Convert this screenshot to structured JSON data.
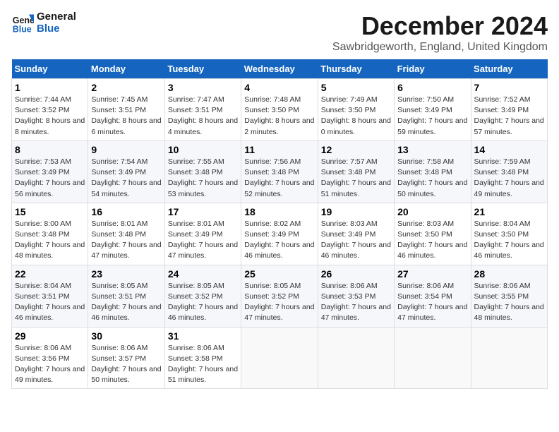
{
  "logo": {
    "line1": "General",
    "line2": "Blue"
  },
  "title": "December 2024",
  "location": "Sawbridgeworth, England, United Kingdom",
  "days_of_week": [
    "Sunday",
    "Monday",
    "Tuesday",
    "Wednesday",
    "Thursday",
    "Friday",
    "Saturday"
  ],
  "weeks": [
    [
      {
        "day": "1",
        "sunrise": "7:44 AM",
        "sunset": "3:52 PM",
        "daylight": "8 hours and 8 minutes."
      },
      {
        "day": "2",
        "sunrise": "7:45 AM",
        "sunset": "3:51 PM",
        "daylight": "8 hours and 6 minutes."
      },
      {
        "day": "3",
        "sunrise": "7:47 AM",
        "sunset": "3:51 PM",
        "daylight": "8 hours and 4 minutes."
      },
      {
        "day": "4",
        "sunrise": "7:48 AM",
        "sunset": "3:50 PM",
        "daylight": "8 hours and 2 minutes."
      },
      {
        "day": "5",
        "sunrise": "7:49 AM",
        "sunset": "3:50 PM",
        "daylight": "8 hours and 0 minutes."
      },
      {
        "day": "6",
        "sunrise": "7:50 AM",
        "sunset": "3:49 PM",
        "daylight": "7 hours and 59 minutes."
      },
      {
        "day": "7",
        "sunrise": "7:52 AM",
        "sunset": "3:49 PM",
        "daylight": "7 hours and 57 minutes."
      }
    ],
    [
      {
        "day": "8",
        "sunrise": "7:53 AM",
        "sunset": "3:49 PM",
        "daylight": "7 hours and 56 minutes."
      },
      {
        "day": "9",
        "sunrise": "7:54 AM",
        "sunset": "3:49 PM",
        "daylight": "7 hours and 54 minutes."
      },
      {
        "day": "10",
        "sunrise": "7:55 AM",
        "sunset": "3:48 PM",
        "daylight": "7 hours and 53 minutes."
      },
      {
        "day": "11",
        "sunrise": "7:56 AM",
        "sunset": "3:48 PM",
        "daylight": "7 hours and 52 minutes."
      },
      {
        "day": "12",
        "sunrise": "7:57 AM",
        "sunset": "3:48 PM",
        "daylight": "7 hours and 51 minutes."
      },
      {
        "day": "13",
        "sunrise": "7:58 AM",
        "sunset": "3:48 PM",
        "daylight": "7 hours and 50 minutes."
      },
      {
        "day": "14",
        "sunrise": "7:59 AM",
        "sunset": "3:48 PM",
        "daylight": "7 hours and 49 minutes."
      }
    ],
    [
      {
        "day": "15",
        "sunrise": "8:00 AM",
        "sunset": "3:48 PM",
        "daylight": "7 hours and 48 minutes."
      },
      {
        "day": "16",
        "sunrise": "8:01 AM",
        "sunset": "3:48 PM",
        "daylight": "7 hours and 47 minutes."
      },
      {
        "day": "17",
        "sunrise": "8:01 AM",
        "sunset": "3:49 PM",
        "daylight": "7 hours and 47 minutes."
      },
      {
        "day": "18",
        "sunrise": "8:02 AM",
        "sunset": "3:49 PM",
        "daylight": "7 hours and 46 minutes."
      },
      {
        "day": "19",
        "sunrise": "8:03 AM",
        "sunset": "3:49 PM",
        "daylight": "7 hours and 46 minutes."
      },
      {
        "day": "20",
        "sunrise": "8:03 AM",
        "sunset": "3:50 PM",
        "daylight": "7 hours and 46 minutes."
      },
      {
        "day": "21",
        "sunrise": "8:04 AM",
        "sunset": "3:50 PM",
        "daylight": "7 hours and 46 minutes."
      }
    ],
    [
      {
        "day": "22",
        "sunrise": "8:04 AM",
        "sunset": "3:51 PM",
        "daylight": "7 hours and 46 minutes."
      },
      {
        "day": "23",
        "sunrise": "8:05 AM",
        "sunset": "3:51 PM",
        "daylight": "7 hours and 46 minutes."
      },
      {
        "day": "24",
        "sunrise": "8:05 AM",
        "sunset": "3:52 PM",
        "daylight": "7 hours and 46 minutes."
      },
      {
        "day": "25",
        "sunrise": "8:05 AM",
        "sunset": "3:52 PM",
        "daylight": "7 hours and 47 minutes."
      },
      {
        "day": "26",
        "sunrise": "8:06 AM",
        "sunset": "3:53 PM",
        "daylight": "7 hours and 47 minutes."
      },
      {
        "day": "27",
        "sunrise": "8:06 AM",
        "sunset": "3:54 PM",
        "daylight": "7 hours and 47 minutes."
      },
      {
        "day": "28",
        "sunrise": "8:06 AM",
        "sunset": "3:55 PM",
        "daylight": "7 hours and 48 minutes."
      }
    ],
    [
      {
        "day": "29",
        "sunrise": "8:06 AM",
        "sunset": "3:56 PM",
        "daylight": "7 hours and 49 minutes."
      },
      {
        "day": "30",
        "sunrise": "8:06 AM",
        "sunset": "3:57 PM",
        "daylight": "7 hours and 50 minutes."
      },
      {
        "day": "31",
        "sunrise": "8:06 AM",
        "sunset": "3:58 PM",
        "daylight": "7 hours and 51 minutes."
      },
      null,
      null,
      null,
      null
    ]
  ]
}
